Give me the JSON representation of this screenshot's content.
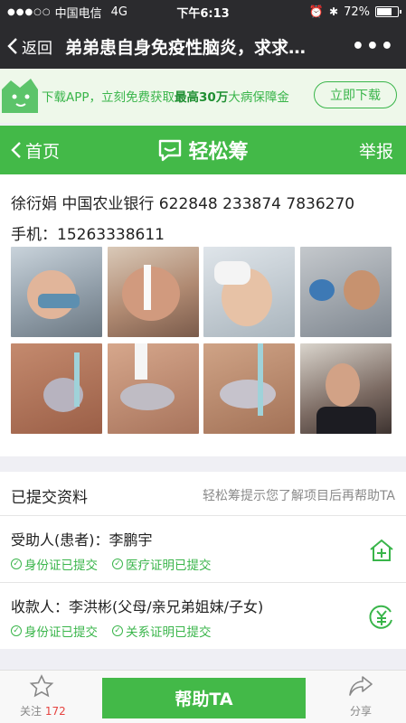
{
  "status": {
    "carrier": "中国电信",
    "network": "4G",
    "time": "下午6:13",
    "battery": "72%",
    "battery_level": 0.72
  },
  "nav": {
    "back_label": "返回",
    "title": "弟弟患自身免疫性脑炎，求求…",
    "more": "•••"
  },
  "banner": {
    "text_prefix": "下载APP，立刻免费获取",
    "text_bold": "最高30万",
    "text_suffix": "大病保障金",
    "button": "立即下载"
  },
  "header": {
    "home": "首页",
    "brand": "轻松筹",
    "report": "举报"
  },
  "content": {
    "bank_line": "徐衍娟 中国农业银行 622848 233874 7836270",
    "phone_line": "手机：15263338611"
  },
  "section": {
    "title": "已提交资料",
    "tip": "轻松筹提示您了解项目后再帮助TA",
    "patient": {
      "title": "受助人(患者)：李鹏宇",
      "badges": [
        "身份证已提交",
        "医疗证明已提交"
      ]
    },
    "payee": {
      "title": "收款人：李洪彬(父母/亲兄弟姐妹/子女)",
      "badges": [
        "身份证已提交",
        "关系证明已提交"
      ]
    }
  },
  "tabbar": {
    "follow_label": "关注",
    "follow_count": "172",
    "help_button": "帮助TA",
    "share_label": "分享"
  },
  "colors": {
    "brand_green": "#43b948",
    "nav_dark": "#2b2b2e",
    "count_red": "#e64340"
  }
}
